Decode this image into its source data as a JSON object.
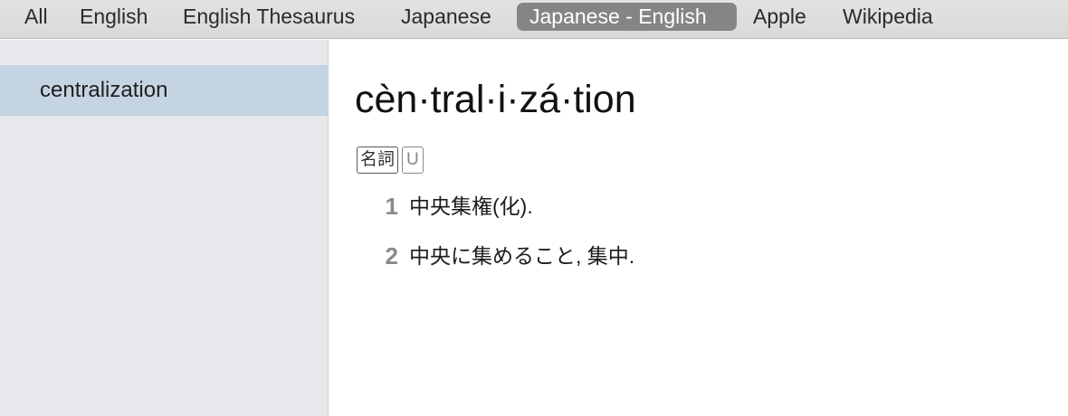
{
  "tabs": [
    {
      "label": "All",
      "selected": false
    },
    {
      "label": "English",
      "selected": false
    },
    {
      "label": "English Thesaurus",
      "selected": false
    },
    {
      "label": "Japanese",
      "selected": false
    },
    {
      "label": "Japanese - English",
      "selected": true
    },
    {
      "label": "Apple",
      "selected": false
    },
    {
      "label": "Wikipedia",
      "selected": false
    }
  ],
  "sidebar": {
    "items": [
      {
        "label": "centralization",
        "selected": true
      }
    ]
  },
  "entry": {
    "headword": "cèn·tral·i·zá·tion",
    "tags": [
      "名詞",
      "U"
    ],
    "senses": [
      {
        "num": "1",
        "definition": "中央集権(化)."
      },
      {
        "num": "2",
        "definition": "中央に集めること, 集中."
      }
    ]
  },
  "colors": {
    "selected_tab_bg": "#858585",
    "sidebar_selected_bg": "#c5d4e2"
  }
}
